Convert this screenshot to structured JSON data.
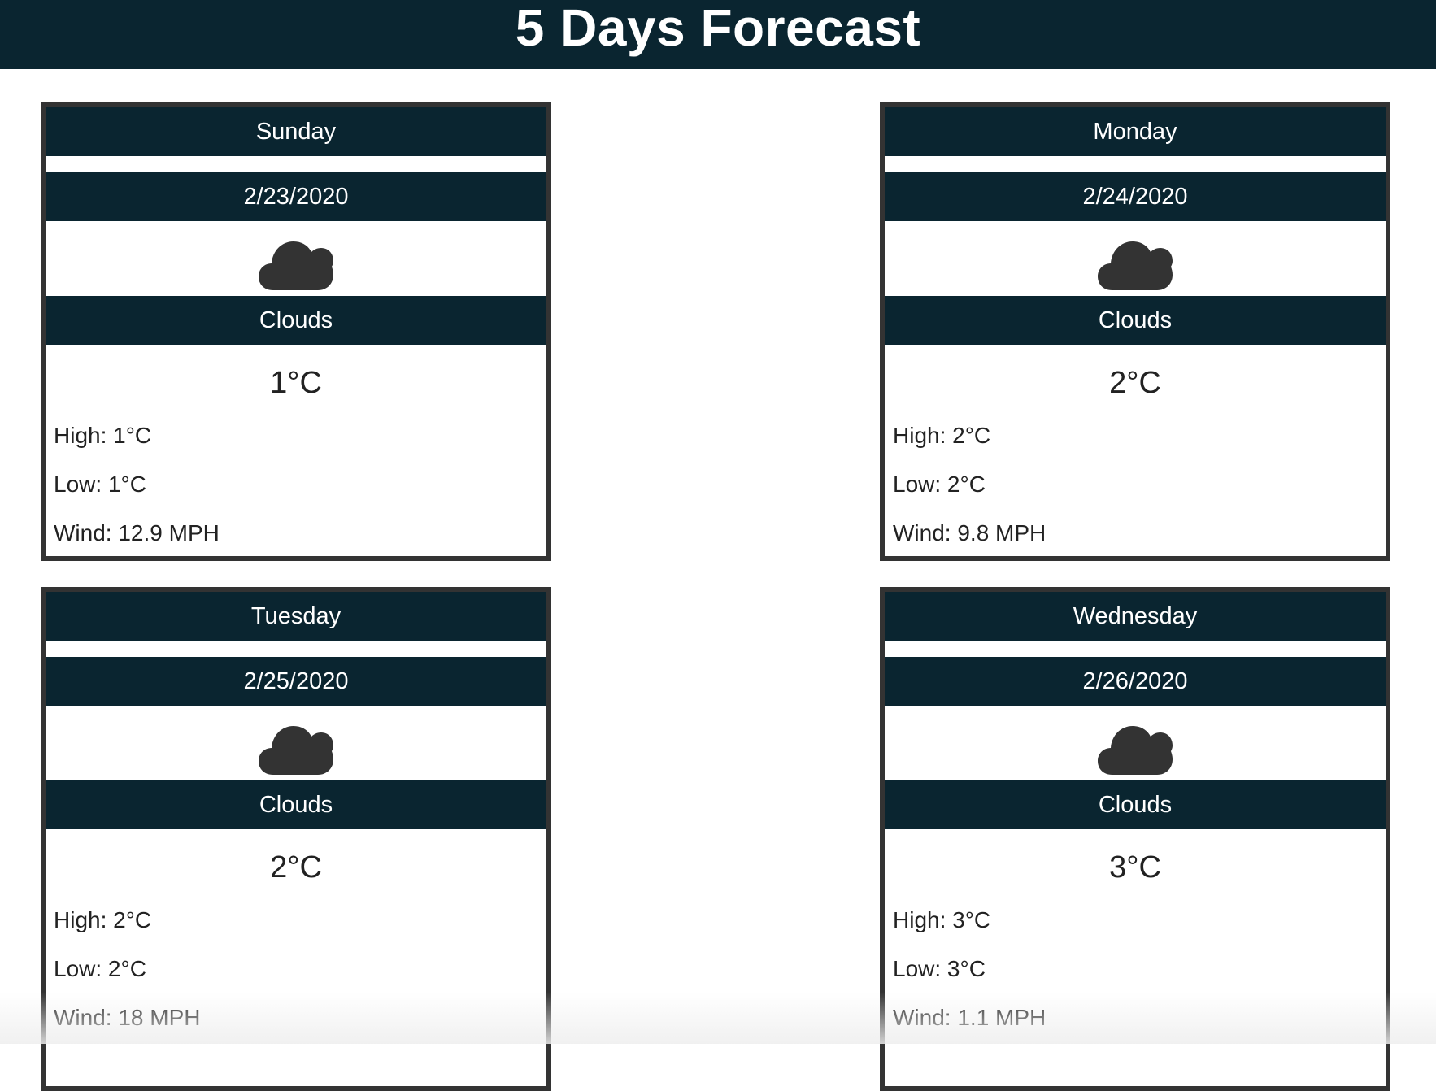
{
  "header": {
    "title": "5 Days Forecast"
  },
  "cloud_icon_color": "#333333",
  "accent_color": "#0a2530",
  "forecast": [
    {
      "day": "Sunday",
      "date": "2/23/2020",
      "icon": "cloud-icon",
      "description": "Clouds",
      "temp": "1°C",
      "high": "High: 1°C",
      "low": "Low: 1°C",
      "wind": "Wind: 12.9 MPH"
    },
    {
      "day": "Monday",
      "date": "2/24/2020",
      "icon": "cloud-icon",
      "description": "Clouds",
      "temp": "2°C",
      "high": "High: 2°C",
      "low": "Low: 2°C",
      "wind": "Wind: 9.8 MPH"
    },
    {
      "day": "Tuesday",
      "date": "2/25/2020",
      "icon": "cloud-icon",
      "description": "Clouds",
      "temp": "2°C",
      "high": "High: 2°C",
      "low": "Low: 2°C",
      "wind": "Wind: 18 MPH"
    },
    {
      "day": "Wednesday",
      "date": "2/26/2020",
      "icon": "cloud-icon",
      "description": "Clouds",
      "temp": "3°C",
      "high": "High: 3°C",
      "low": "Low: 3°C",
      "wind": "Wind: 1.1 MPH"
    }
  ]
}
